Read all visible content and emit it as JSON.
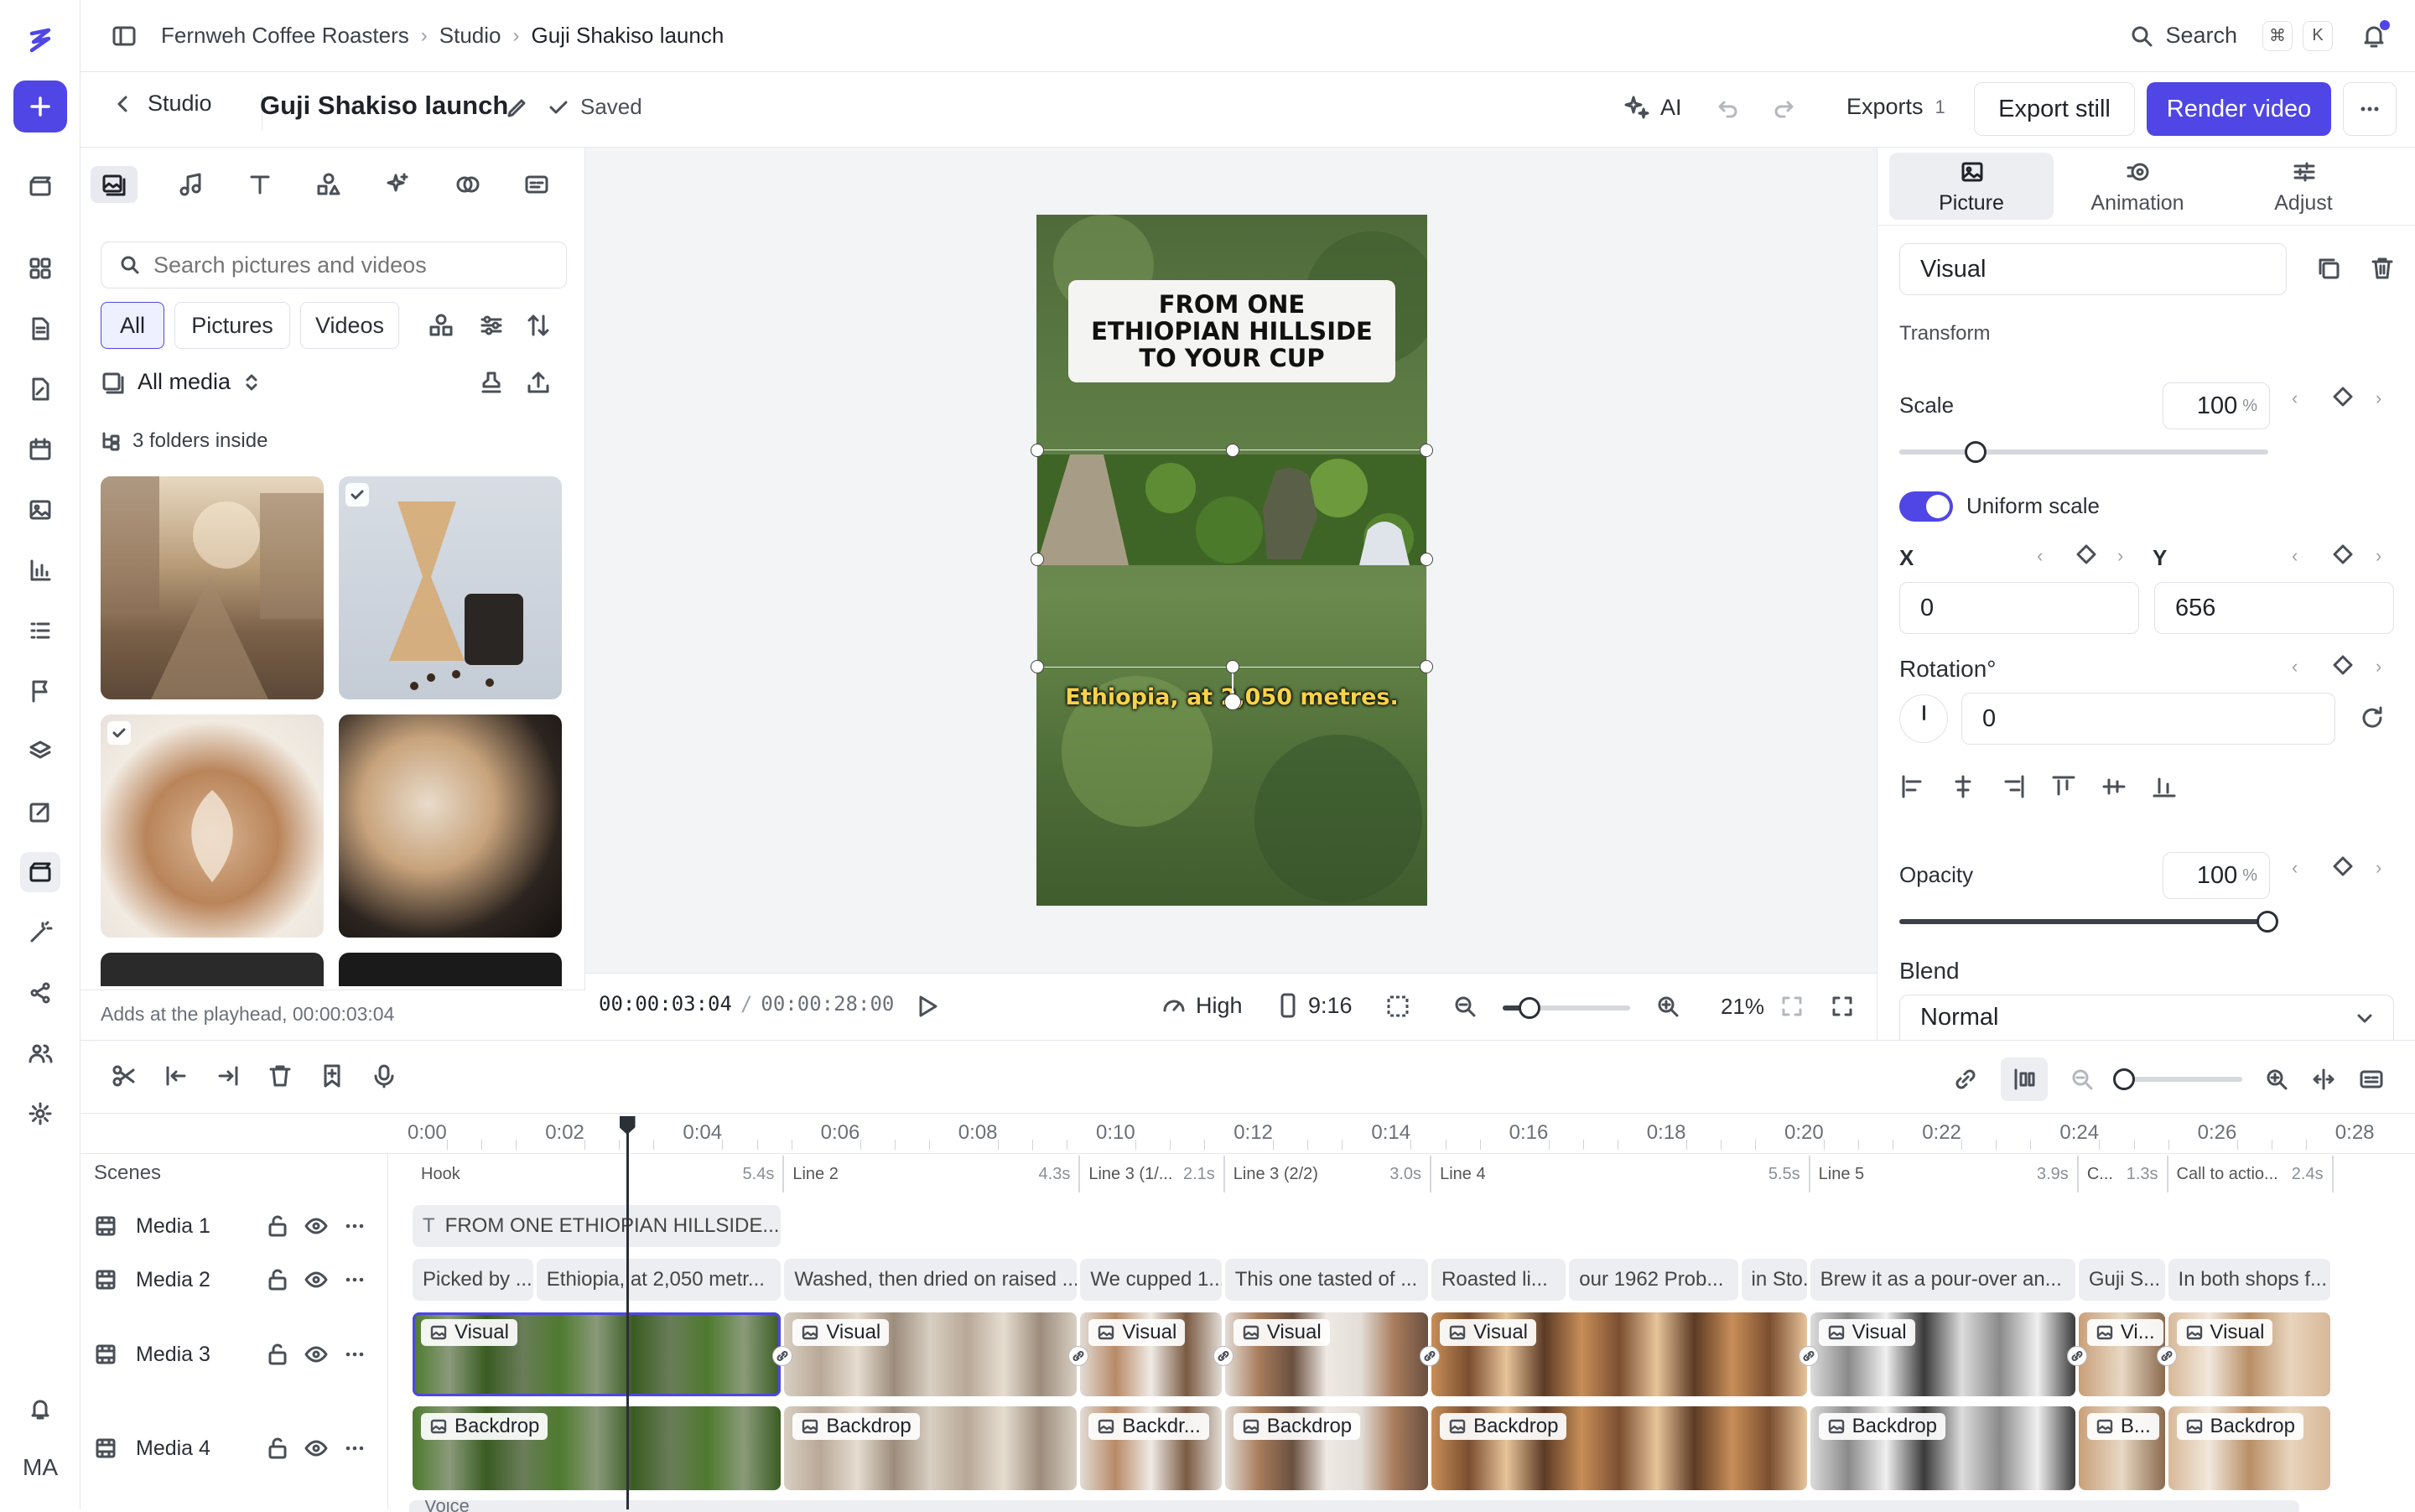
{
  "breadcrumb": [
    "Fernweh Coffee Roasters",
    "Studio",
    "Guji Shakiso launch"
  ],
  "search": {
    "label": "Search",
    "keys": [
      "⌘",
      "K"
    ]
  },
  "subbar": {
    "back_label": "Studio",
    "project_title": "Guji Shakiso launch",
    "saved_label": "Saved",
    "ai_label": "AI",
    "exports_label": "Exports",
    "exports_count": "1",
    "export_still": "Export still",
    "render_video": "Render video"
  },
  "rail": {
    "user_initials": "MA"
  },
  "media": {
    "search_placeholder": "Search pictures and videos",
    "filters": [
      "All",
      "Pictures",
      "Videos"
    ],
    "active_filter": "All",
    "source_label": "All media",
    "folders_label": "3 folders inside",
    "footer": "Adds at the playhead, 00:00:03:04"
  },
  "canvas": {
    "headline": "FROM ONE ETHIOPIAN HILLSIDE TO YOUR CUP",
    "caption": "Ethiopia, at 2,050 metres.",
    "timecode_current": "00:00:03:04",
    "timecode_total": "00:00:28:00",
    "quality": "High",
    "aspect": "9:16",
    "zoom": "21%",
    "zoom_level": 0.21
  },
  "inspector": {
    "tabs": [
      "Picture",
      "Animation",
      "Adjust"
    ],
    "active_tab": "Picture",
    "layer_name": "Visual",
    "section_transform": "Transform",
    "scale_label": "Scale",
    "scale_value": "100",
    "scale_unit": "%",
    "uniform_label": "Uniform scale",
    "uniform_on": true,
    "x_label": "X",
    "x_value": "0",
    "y_label": "Y",
    "y_value": "656",
    "rotation_label": "Rotation°",
    "rotation_value": "0",
    "opacity_label": "Opacity",
    "opacity_value": "100",
    "opacity_unit": "%",
    "blend_label": "Blend",
    "blend_value": "Normal"
  },
  "timeline": {
    "ruler": [
      "0:00",
      "0:02",
      "0:04",
      "0:06",
      "0:08",
      "0:10",
      "0:12",
      "0:14",
      "0:16",
      "0:18",
      "0:20",
      "0:22",
      "0:24",
      "0:26",
      "0:28"
    ],
    "playhead_seconds": 3.1,
    "scenes_label": "Scenes",
    "scenes": [
      {
        "name": "Hook",
        "dur": "5.4s"
      },
      {
        "name": "Line 2",
        "dur": "4.3s"
      },
      {
        "name": "Line 3 (1/...",
        "dur": "2.1s"
      },
      {
        "name": "Line 3 (2/2)",
        "dur": "3.0s"
      },
      {
        "name": "Line 4",
        "dur": "5.5s"
      },
      {
        "name": "Line 5",
        "dur": "3.9s"
      },
      {
        "name": "C...",
        "dur": "1.3s"
      },
      {
        "name": "Call to actio...",
        "dur": "2.4s"
      }
    ],
    "tracks": [
      "Media 1",
      "Media 2",
      "Media 3",
      "Media 4"
    ],
    "media1_clip": "FROM ONE ETHIOPIAN HILLSIDE...",
    "media2_clips": [
      "Picked by ...",
      "Ethiopia, at 2,050 metr...",
      "Washed, then dried on raised ...",
      "We cupped 1...",
      "This one tasted of ...",
      "Roasted li...",
      "our 1962 Prob...",
      "in Sto...",
      "Brew it as a pour-over an...",
      "Guji S...",
      "In both shops f..."
    ],
    "media3_clips": [
      "Visual",
      "Visual",
      "Visual",
      "Visual",
      "Visual",
      "Visual",
      "Vi...",
      "Visual"
    ],
    "media4_clips": [
      "Backdrop",
      "Backdrop",
      "Backdr...",
      "Backdrop",
      "Backdrop",
      "Backdrop",
      "B...",
      "Backdrop"
    ],
    "voice_label": "Voice"
  }
}
